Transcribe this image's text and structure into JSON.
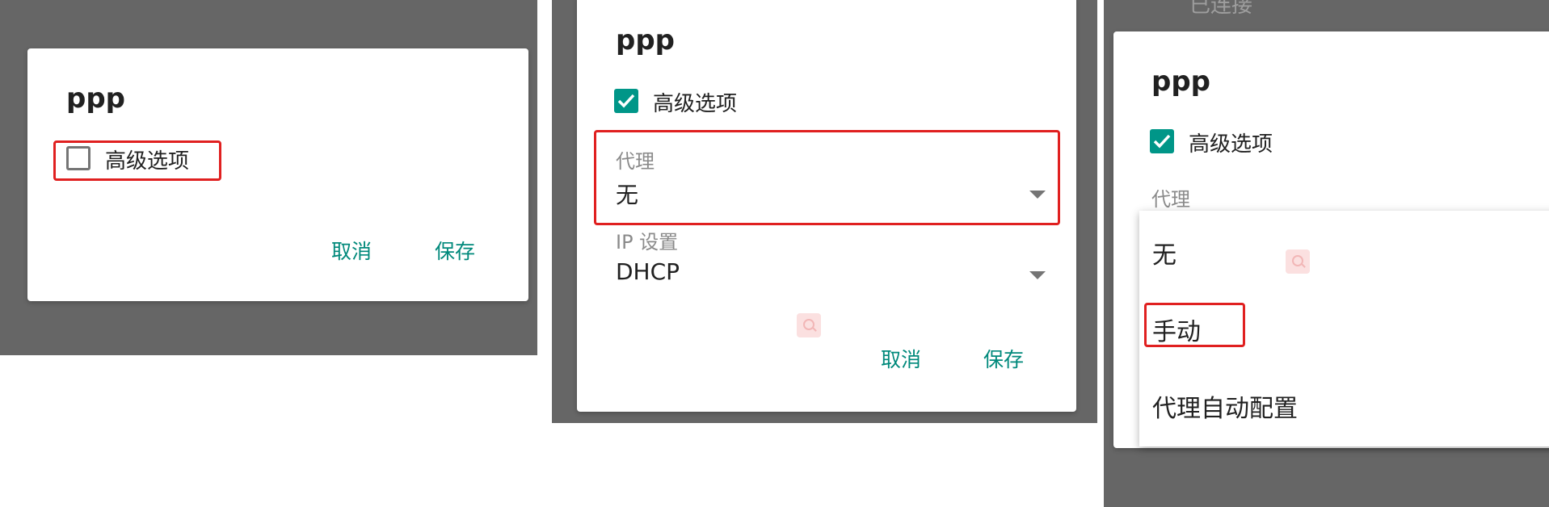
{
  "panel1": {
    "title": "ppp",
    "checkbox_label": "高级选项",
    "checkbox_checked": false,
    "cancel_label": "取消",
    "save_label": "保存"
  },
  "panel2": {
    "title": "ppp",
    "checkbox_label": "高级选项",
    "checkbox_checked": true,
    "proxy_label": "代理",
    "proxy_value": "无",
    "ip_label": "IP 设置",
    "ip_value": "DHCP",
    "cancel_label": "取消",
    "save_label": "保存"
  },
  "panel3": {
    "behind_text": "已连接",
    "title": "ppp",
    "checkbox_label": "高级选项",
    "checkbox_checked": true,
    "proxy_label": "代理",
    "menu_options": [
      "无",
      "手动",
      "代理自动配置"
    ]
  },
  "colors": {
    "accent": "#009688",
    "button_text": "#00897b",
    "highlight": "#e02020",
    "scrim": "#666666"
  },
  "icons": {
    "checkbox_check": "check-icon",
    "dropdown": "dropdown-arrow-icon",
    "watermark": "search-watermark-icon"
  }
}
